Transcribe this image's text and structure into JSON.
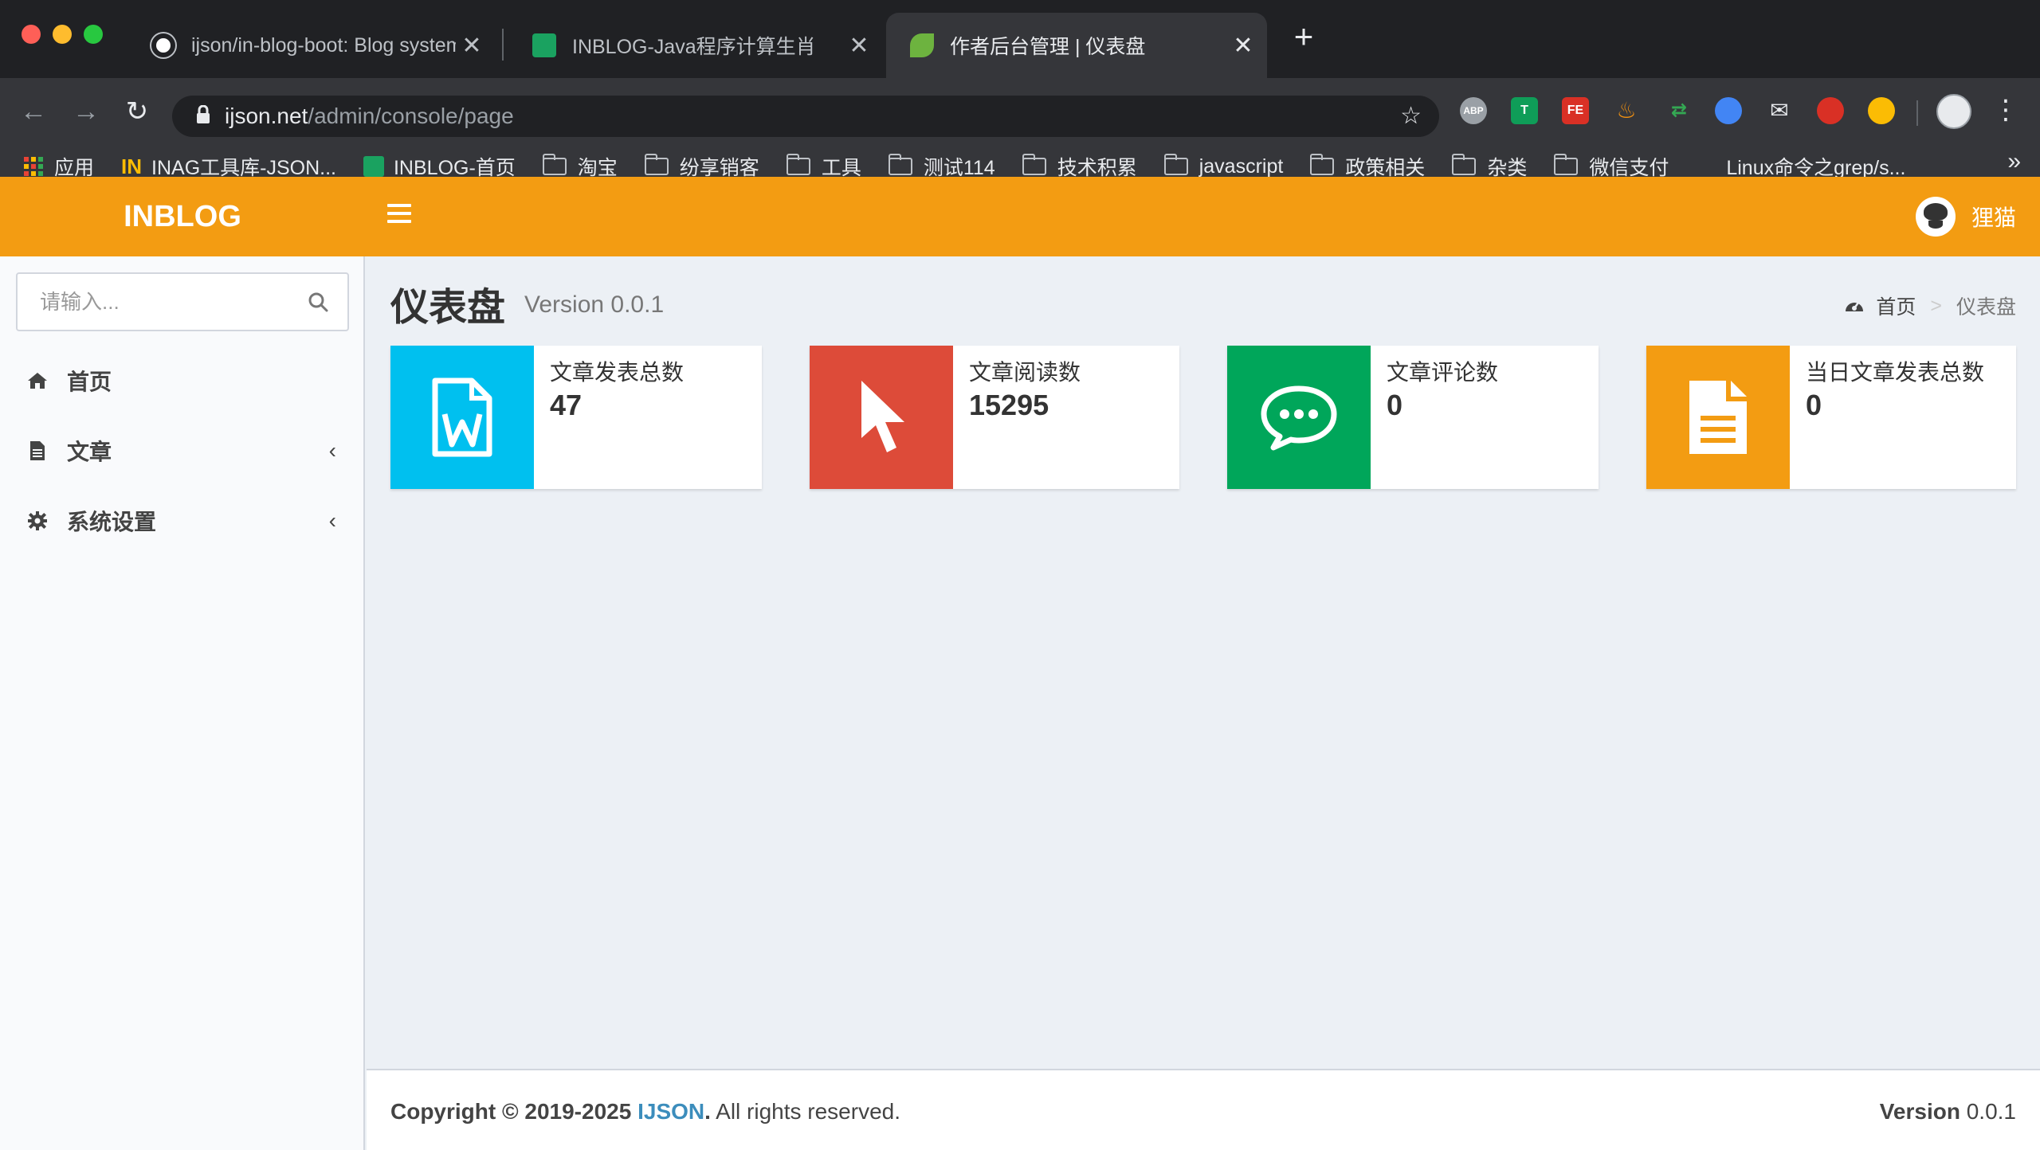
{
  "browser": {
    "tabs": [
      {
        "title": "ijson/in-blog-boot: Blog system"
      },
      {
        "title": "INBLOG-Java程序计算生肖"
      },
      {
        "title": "作者后台管理 | 仪表盘"
      }
    ],
    "url": {
      "host": "ijson.net",
      "path": "/admin/console/page"
    },
    "bookmarks": [
      {
        "label": "应用"
      },
      {
        "label": "INAG工具库-JSON..."
      },
      {
        "label": "INBLOG-首页"
      },
      {
        "label": "淘宝"
      },
      {
        "label": "纷享销客"
      },
      {
        "label": "工具"
      },
      {
        "label": "测试114"
      },
      {
        "label": "技术积累"
      },
      {
        "label": "javascript"
      },
      {
        "label": "政策相关"
      },
      {
        "label": "杂类"
      },
      {
        "label": "微信支付"
      },
      {
        "label": "Linux命令之grep/s..."
      }
    ],
    "more_label": "»",
    "extensions": [
      {
        "icon": "adblock-icon",
        "text": "ABP"
      },
      {
        "icon": "translate-icon",
        "text": "T"
      },
      {
        "icon": "fe-helper-icon",
        "text": "FE"
      }
    ]
  },
  "header": {
    "logo": "INBLOG",
    "user_name": "狸猫"
  },
  "sidebar": {
    "search_placeholder": "请输入...",
    "items": [
      {
        "label": "首页",
        "icon": "home-icon"
      },
      {
        "label": "文章",
        "icon": "file-icon"
      },
      {
        "label": "系统设置",
        "icon": "gear-icon"
      }
    ]
  },
  "page": {
    "title": "仪表盘",
    "version": "Version 0.0.1",
    "breadcrumb": {
      "home": "首页",
      "separator": ">",
      "current": "仪表盘"
    }
  },
  "stats": [
    {
      "label": "文章发表总数",
      "value": "47",
      "color": "#00c0ef",
      "icon": "word-file-icon"
    },
    {
      "label": "文章阅读数",
      "value": "15295",
      "color": "#dd4b39",
      "icon": "cursor-icon"
    },
    {
      "label": "文章评论数",
      "value": "0",
      "color": "#00a65a",
      "icon": "comment-icon"
    },
    {
      "label": "当日文章发表总数",
      "value": "0",
      "color": "#f39c12",
      "icon": "document-icon"
    }
  ],
  "footer": {
    "copyright_prefix": "Copyright © 2019-2025",
    "copyright_link": "IJSON",
    "copyright_suffix": "All rights reserved.",
    "version_label": "Version",
    "version_value": "0.0.1"
  },
  "colors": {
    "header": "#f39c12",
    "link": "#3c8dbc"
  }
}
